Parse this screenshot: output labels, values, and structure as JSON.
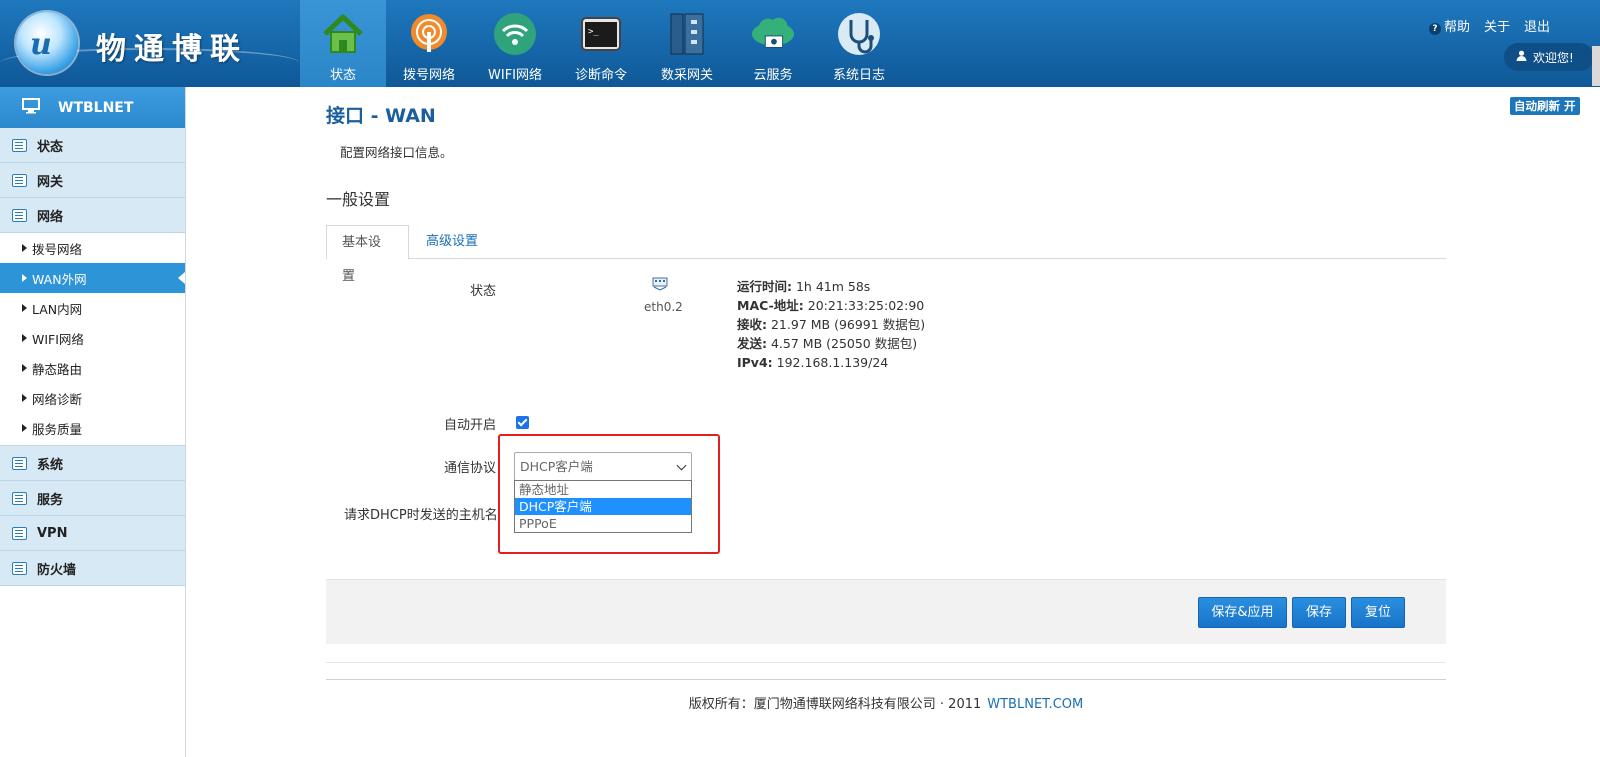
{
  "brand": {
    "name": "物通博联",
    "logo_icon": "wt-globe-logo-icon"
  },
  "nav": [
    {
      "label": "状态",
      "icon": "home-icon",
      "active": true
    },
    {
      "label": "拨号网络",
      "icon": "dial-antenna-icon",
      "active": false
    },
    {
      "label": "WIFI网络",
      "icon": "wifi-icon",
      "active": false
    },
    {
      "label": "诊断命令",
      "icon": "terminal-icon",
      "active": false
    },
    {
      "label": "数采网关",
      "icon": "gateway-rack-icon",
      "active": false
    },
    {
      "label": "云服务",
      "icon": "cloud-icon",
      "active": false
    },
    {
      "label": "系统日志",
      "icon": "stethoscope-icon",
      "active": false
    }
  ],
  "top_links": {
    "help": "帮助",
    "about": "关于",
    "logout": "退出",
    "welcome": "欢迎您!"
  },
  "sidebar": {
    "title": "WTBLNET",
    "categories": [
      {
        "label": "状态"
      },
      {
        "label": "网关"
      },
      {
        "label": "网络"
      },
      {
        "label": "系统"
      },
      {
        "label": "服务"
      },
      {
        "label": "VPN"
      },
      {
        "label": "防火墙"
      }
    ],
    "network_items": [
      {
        "label": "拨号网络"
      },
      {
        "label": "WAN外网",
        "active": true
      },
      {
        "label": "LAN内网"
      },
      {
        "label": "WIFI网络"
      },
      {
        "label": "静态路由"
      },
      {
        "label": "网络诊断"
      },
      {
        "label": "服务质量"
      }
    ]
  },
  "main": {
    "title": "接口 - WAN",
    "description": "配置网络接口信息。",
    "auto_refresh": "自动刷新 开",
    "section": "一般设置",
    "tabs": [
      "基本设置",
      "高级设置"
    ],
    "status_label": "状态",
    "iface": "eth0.2",
    "status": {
      "uptime_label": "运行时间:",
      "uptime": "1h 41m 58s",
      "mac_label": "MAC-地址:",
      "mac": "20:21:33:25:02:90",
      "rx_label": "接收:",
      "rx": "21.97 MB (96991 数据包)",
      "tx_label": "发送:",
      "tx": "4.57 MB (25050 数据包)",
      "ipv4_label": "IPv4:",
      "ipv4": "192.168.1.139/24"
    },
    "auto_start_label": "自动开启",
    "auto_start_checked": true,
    "protocol_label": "通信协议",
    "protocol_value": "DHCP客户端",
    "protocol_options": [
      "静态地址",
      "DHCP客户端",
      "PPPoE"
    ],
    "hostname_label": "请求DHCP时发送的主机名",
    "buttons": {
      "save_apply": "保存&应用",
      "save": "保存",
      "reset": "复位"
    },
    "footer": {
      "text": "版权所有：厦门物通博联网络科技有限公司 · 2011",
      "link": "WTBLNET.COM"
    }
  },
  "colors": {
    "header": "#1565a8",
    "accent": "#2d94d8",
    "highlight_box": "#e02020",
    "button": "#1874c9"
  }
}
